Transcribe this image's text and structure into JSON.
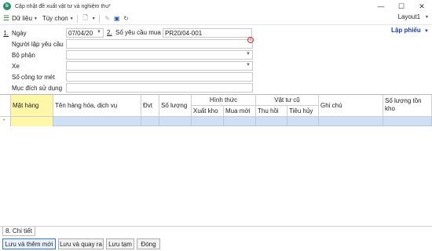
{
  "window": {
    "title": "Cập nhật đề xuất vật tư và nghiệm thu*",
    "app_icon": "app-logo-icon",
    "controls": [
      "—",
      "☐",
      "✕"
    ]
  },
  "toolbar": {
    "data_menu": "Dữ liệu",
    "options_menu": "Tùy chọn",
    "layout_value": "Layout1"
  },
  "form": {
    "fields": [
      {
        "num": "1.",
        "label": "Ngày",
        "value": "07/04/20"
      },
      {
        "num": "",
        "label": "Người lập yêu cầu",
        "value": ""
      },
      {
        "num": "",
        "label": "Bộ phận",
        "value": ""
      },
      {
        "num": "",
        "label": "Xe",
        "value": ""
      },
      {
        "num": "",
        "label": "Số công tơ mét",
        "value": ""
      },
      {
        "num": "",
        "label": "Mục đích sử dụng",
        "value": ""
      }
    ],
    "req_number": {
      "num": "2.",
      "label": "Số yêu cầu mua",
      "value": "PR20/04-001"
    },
    "lap_phieu": "Lập phiếu",
    "error_mark": "!"
  },
  "grid": {
    "headers": {
      "mat_hang": "Mặt hàng",
      "ten_hang": "Tên hàng hóa, dịch vụ",
      "dvt": "Đvt",
      "so_luong": "Số lượng",
      "hinh_thuc": "Hình thức",
      "xuat_kho": "Xuất kho",
      "mua_moi": "Mua mới",
      "vat_tu_cu": "Vật tư cũ",
      "thu_hoi": "Thu hồi",
      "tieu_huy": "Tiêu hủy",
      "ghi_chu": "Ghi chú",
      "so_luong_ton": "Số lượng tồn kho"
    },
    "row_marker": "•"
  },
  "tabs": {
    "chi_tiet": "8. Chi tiết"
  },
  "buttons": {
    "save_new": "Lưu và thêm mới",
    "save_close": "Lưu và quay ra",
    "save_temp": "Lưu tạm",
    "close": "Đóng"
  }
}
